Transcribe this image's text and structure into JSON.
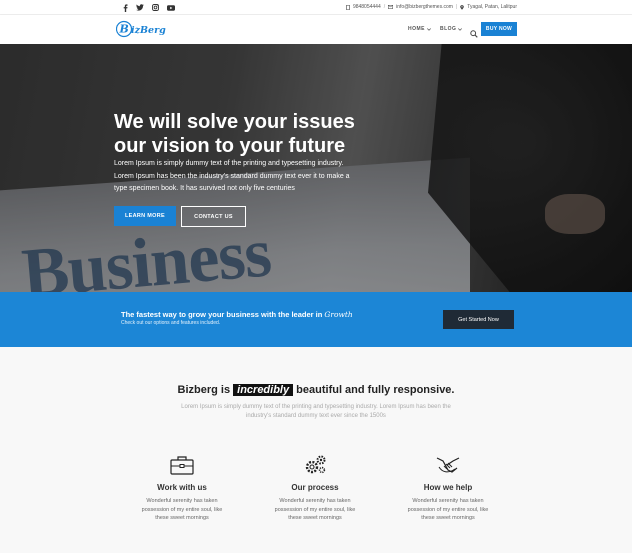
{
  "topbar": {
    "social_icons": [
      "facebook-icon",
      "twitter-icon",
      "instagram-icon",
      "youtube-icon"
    ],
    "phone": "9848054444",
    "email": "info@bizbergthemes.com",
    "address": "Tyagal, Patan, Lalitpur"
  },
  "header": {
    "logo_text": "BizBerg",
    "nav": [
      {
        "label": "HOME"
      },
      {
        "label": "BLOG"
      }
    ],
    "buy_label": "BUY NOW"
  },
  "hero": {
    "title_line1": "We will solve your issues",
    "title_line2": "our vision to your future",
    "text": "Lorem Ipsum is simply dummy text of the printing and typesetting industry. Lorem Ipsum has been the industry's standard dummy text ever it to make a type specimen book. It has survived not only five centuries",
    "learn_label": "LEARN MORE",
    "contact_label": "CONTACT US",
    "background_word": "Business"
  },
  "band": {
    "title": "The fastest way to grow your business with the leader in",
    "title_script": "Growth",
    "subtitle": "Check out our options and features included.",
    "button_label": "Get Started Now"
  },
  "features": {
    "heading_pre": "Bizberg is",
    "heading_highlight": "incredibly",
    "heading_post": "beautiful and fully responsive.",
    "description": "Lorem Ipsum is simply dummy text of the printing and typesetting industry. Lorem Ipsum has been the industry's standard dummy text ever since the 1500s",
    "cards": [
      {
        "icon": "briefcase-icon",
        "title": "Work with us",
        "text": "Wonderful serenity has taken possession of my entire soul, like these sweet mornings"
      },
      {
        "icon": "gears-icon",
        "title": "Our process",
        "text": "Wonderful serenity has taken possession of my entire soul, like these sweet mornings"
      },
      {
        "icon": "handshake-icon",
        "title": "How we help",
        "text": "Wonderful serenity has taken possession of my entire soul, like these sweet mornings"
      }
    ]
  },
  "colors": {
    "accent": "#1a82d4",
    "band": "#1c86d6",
    "dark_button": "#1f2a36"
  }
}
